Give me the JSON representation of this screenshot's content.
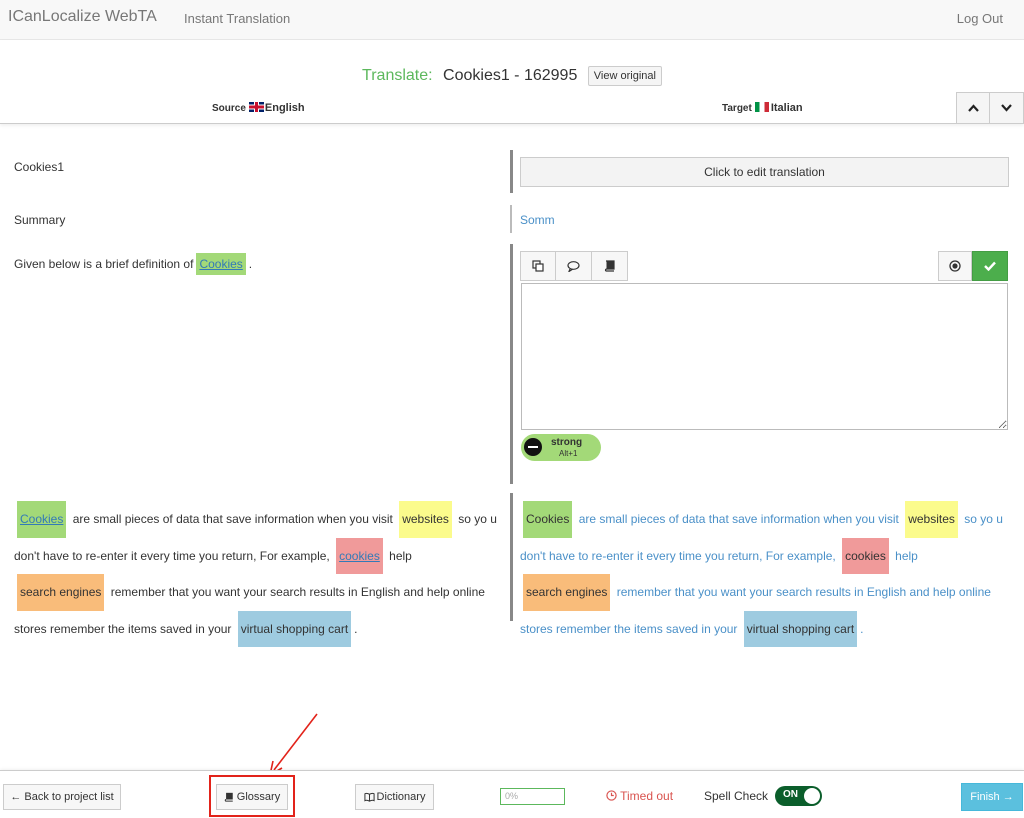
{
  "navbar": {
    "brand": "ICanLocalize WebTA",
    "instant": "Instant Translation",
    "logout": "Log Out"
  },
  "header": {
    "title_label": "Translate:",
    "title_name": "Cookies1 - 162995",
    "view_original": "View original",
    "source_prefix": "Source",
    "source_lang": "English",
    "target_prefix": "Target",
    "target_lang": "Italian",
    "up_icon": "chevron-up-icon",
    "down_icon": "chevron-down-icon"
  },
  "rows": {
    "title_src": "Cookies1",
    "title_tgt_button": "Click to edit translation",
    "summary_src": "Summary",
    "summary_tgt": "Somm",
    "def_src_before": "Given below is a brief definition of",
    "def_src_term": "Cookies",
    "def_src_after": "."
  },
  "editor": {
    "value": "",
    "tag_name": "strong",
    "tag_shortcut": "Alt+1",
    "tool_icons": [
      "copy-icon",
      "comment-icon",
      "book-icon"
    ],
    "tools_right_icons": [
      "radio-icon",
      "check-icon"
    ]
  },
  "paragraph_src": {
    "t1": "Cookies",
    "s1": "are small pieces of data that save information when you visit",
    "t2": "websites",
    "s2": "so yo u don't have to re-enter it every time you return, For example,",
    "t3": "cookies",
    "s3": "help",
    "t4": "search engines",
    "s4": "remember that you want your search results in English and help online stores remember the items saved in your",
    "t5": "virtual shopping cart",
    "s5": "."
  },
  "paragraph_tgt": {
    "t1": "Cookies",
    "s1": "are small pieces of data that save information when you visit",
    "t2": "websites",
    "s2": "so yo u don't have to re-enter it every time you return, For example,",
    "t3": "cookies",
    "s3": "help",
    "t4": "search engines",
    "s4": "remember that you want your search results in English and help online stores remember the items saved in your",
    "t5": "virtual shopping cart",
    "s5": "."
  },
  "footer": {
    "back": "← Back to project list",
    "glossary": "Glossary",
    "dictionary": "Dictionary",
    "progress": "0%",
    "timed_out": "Timed out",
    "spell_check": "Spell Check",
    "spell_state": "ON",
    "finish": "Finish →"
  },
  "colors": {
    "brand_green": "#5cb85c",
    "link_blue": "#4a90c8",
    "term_green": "#a3d978",
    "term_yellow": "#fbfb8c",
    "term_red": "#f09a9a",
    "term_orange": "#f9bc7a",
    "term_blue": "#9ecbe0",
    "finish_blue": "#5bc0de",
    "annotation_red": "#e2231a"
  }
}
